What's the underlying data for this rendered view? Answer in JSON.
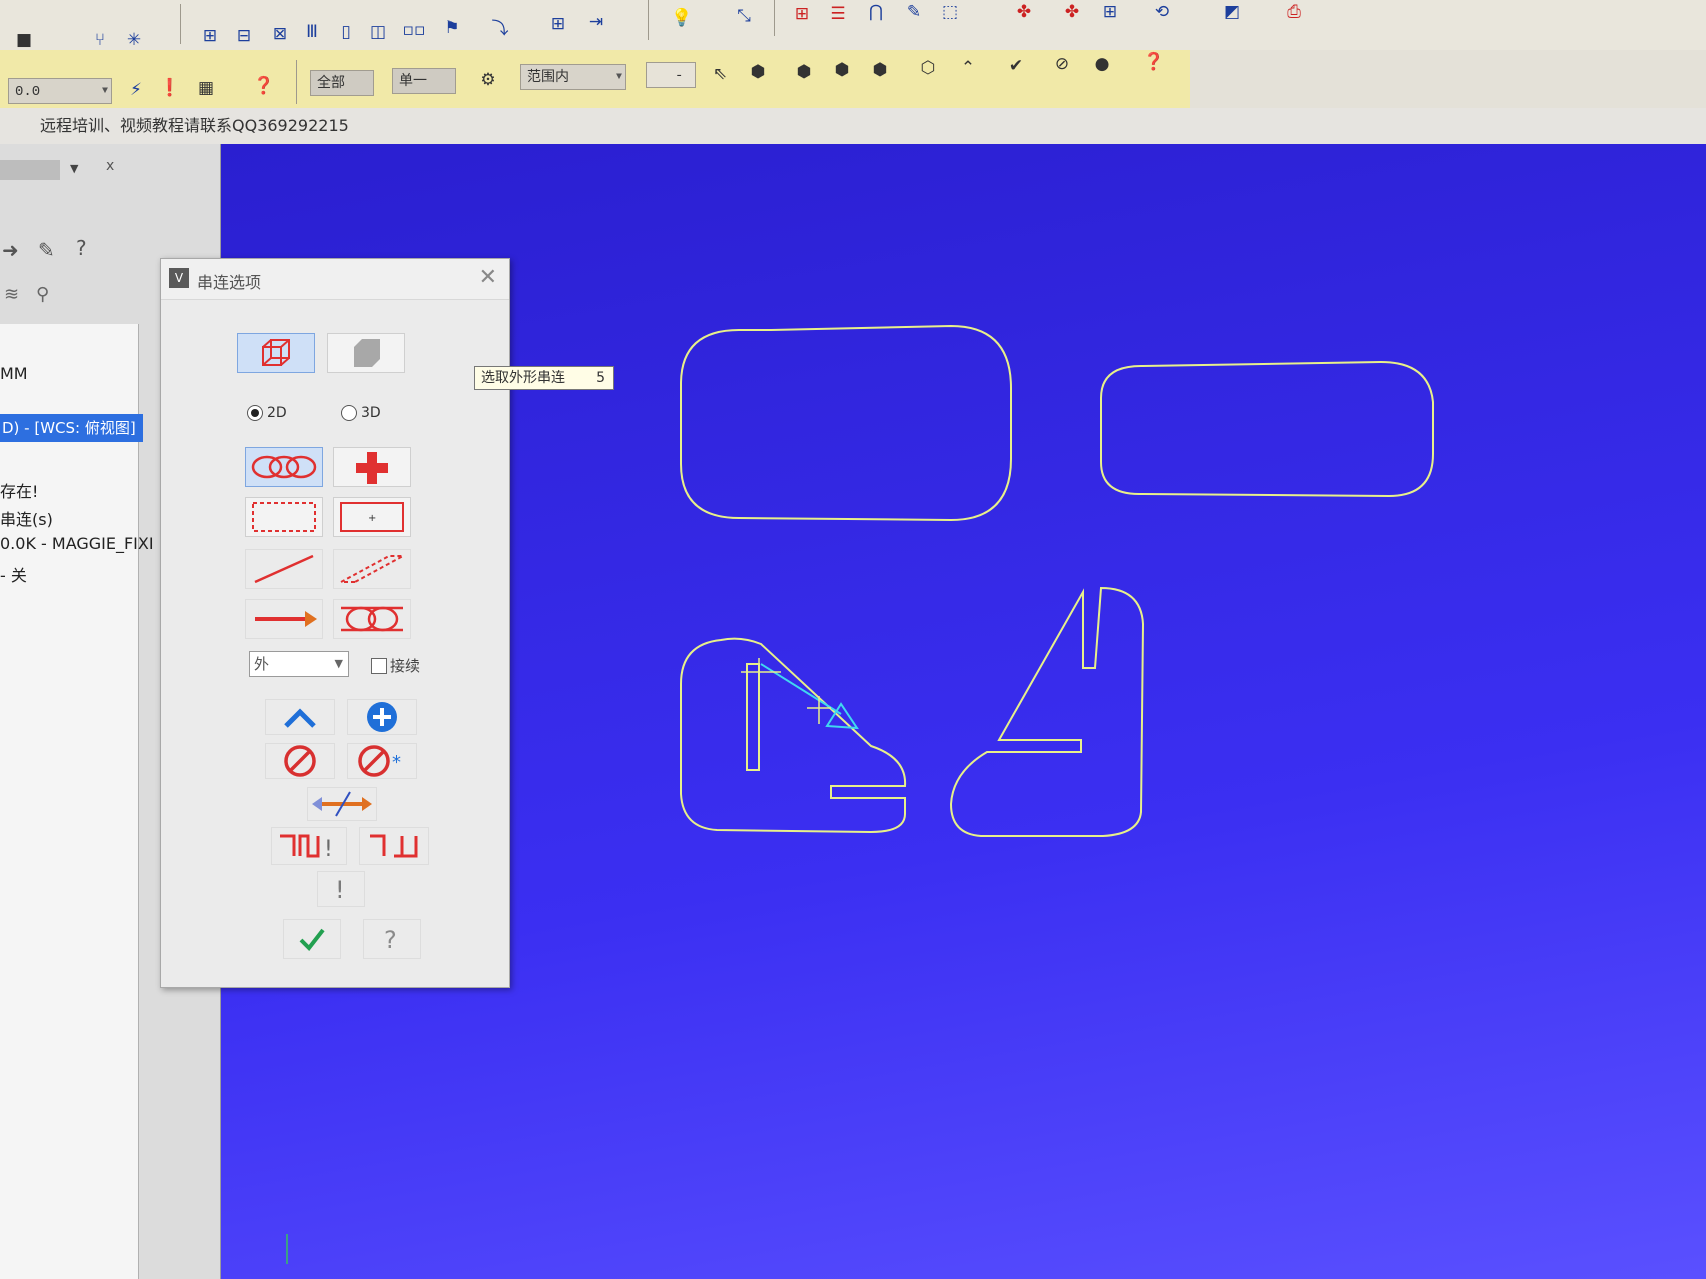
{
  "toolbar_row2": {
    "zoom_value": "0.0",
    "filter_all": "全部",
    "filter_single": "单一",
    "filter_range": "范围内",
    "blank_field": "-"
  },
  "status_text": "远程培训、视频教程请联系QQ369292215",
  "left_panel": {
    "close_label": "x",
    "unit": "MM",
    "selected_item": "D) - [WCS: 俯视图]",
    "lines": [
      "存在!",
      "串连(s)",
      "0.0K - MAGGIE_FIXI",
      "- 关"
    ]
  },
  "dialog": {
    "title": "串连选项",
    "radio_2d": "2D",
    "radio_3d": "3D",
    "mode_select": "外",
    "checkbox_label": "接续",
    "checkbox_checked": false
  },
  "tooltip": {
    "text": "选取外形串连",
    "shortcut": "5"
  },
  "colors": {
    "viewport": "#2b22d8",
    "geometry": "#e8f08a",
    "selection_tip": "#40d8f0",
    "dialog_icon": "#e03030",
    "accent": "#2d6fe0"
  }
}
